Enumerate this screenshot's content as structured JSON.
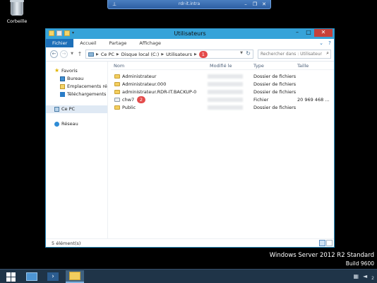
{
  "desktop": {
    "recycle_bin_label": "Corbeille",
    "watermark_line1": "Windows Server 2012 R2 Standard",
    "watermark_line2": "Build 9600"
  },
  "rdp": {
    "host": "rdr-it.intra"
  },
  "window": {
    "title": "Utilisateurs",
    "tabs": [
      "Fichier",
      "Accueil",
      "Partage",
      "Affichage"
    ],
    "address": {
      "segments": [
        "Ce PC",
        "Disque local (C:)",
        "Utilisateurs"
      ],
      "marker": "1"
    },
    "search_placeholder": "Rechercher dans : Utilisateurs"
  },
  "navpane": {
    "favorites": "Favoris",
    "favorites_items": [
      "Bureau",
      "Emplacements récents",
      "Téléchargements"
    ],
    "this_pc": "Ce PC",
    "network": "Réseau"
  },
  "table": {
    "columns": [
      "Nom",
      "Modifié le",
      "Type",
      "Taille"
    ],
    "rows": [
      {
        "name": "Administrateur",
        "type": "Dossier de fichiers",
        "size": ""
      },
      {
        "name": "Administrateur.000",
        "type": "Dossier de fichiers",
        "size": ""
      },
      {
        "name": "administrateur.RDR-IT.BACKUP-0",
        "type": "Dossier de fichiers",
        "size": ""
      },
      {
        "name": "chw7",
        "type": "Fichier",
        "size": "20 969 468 ...",
        "marker": "2"
      },
      {
        "name": "Public",
        "type": "Dossier de fichiers",
        "size": ""
      }
    ]
  },
  "status": {
    "count": "5 élément(s)"
  },
  "colors": {
    "accent": "#36a3d9",
    "marker": "#e44b4b",
    "taskbar": "#1f3448"
  }
}
